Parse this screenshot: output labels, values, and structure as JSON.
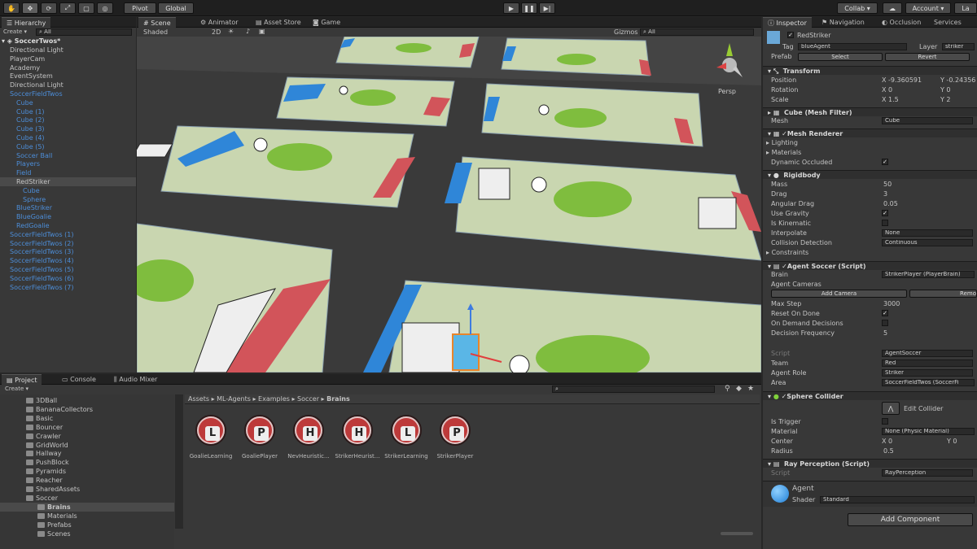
{
  "toolbar": {
    "pivot": "Pivot",
    "global": "Global",
    "collab": "Collab",
    "account": "Account",
    "layers": "La",
    "tool_icons": [
      "hand-icon",
      "move-icon",
      "rotate-icon",
      "scale-icon",
      "rect-icon",
      "transform-icon"
    ]
  },
  "hierarchy": {
    "tab": "Hierarchy",
    "create": "Create",
    "search": "All",
    "scene": "SoccerTwos*",
    "items": [
      {
        "label": "Directional Light",
        "style": "white",
        "indent": 1
      },
      {
        "label": "PlayerCam",
        "style": "white",
        "indent": 1
      },
      {
        "label": "Academy",
        "style": "white",
        "indent": 1
      },
      {
        "label": "EventSystem",
        "style": "white",
        "indent": 1
      },
      {
        "label": "Directional Light",
        "style": "white",
        "indent": 1
      },
      {
        "label": "SoccerFieldTwos",
        "style": "blue",
        "indent": 1
      },
      {
        "label": "Cube",
        "style": "blue",
        "indent": 2
      },
      {
        "label": "Cube (1)",
        "style": "blue",
        "indent": 2
      },
      {
        "label": "Cube (2)",
        "style": "blue",
        "indent": 2
      },
      {
        "label": "Cube (3)",
        "style": "blue",
        "indent": 2
      },
      {
        "label": "Cube (4)",
        "style": "blue",
        "indent": 2
      },
      {
        "label": "Cube (5)",
        "style": "blue",
        "indent": 2
      },
      {
        "label": "Soccer Ball",
        "style": "blue",
        "indent": 2
      },
      {
        "label": "Players",
        "style": "blue",
        "indent": 2
      },
      {
        "label": "Field",
        "style": "blue",
        "indent": 2
      },
      {
        "label": "RedStriker",
        "style": "white",
        "indent": 2,
        "selected": true
      },
      {
        "label": "Cube",
        "style": "blue",
        "indent": 3
      },
      {
        "label": "Sphere",
        "style": "blue",
        "indent": 3
      },
      {
        "label": "BlueStriker",
        "style": "blue",
        "indent": 2
      },
      {
        "label": "BlueGoalie",
        "style": "blue",
        "indent": 2
      },
      {
        "label": "RedGoalie",
        "style": "blue",
        "indent": 2
      },
      {
        "label": "SoccerFieldTwos (1)",
        "style": "blue",
        "indent": 1
      },
      {
        "label": "SoccerFieldTwos (2)",
        "style": "blue",
        "indent": 1
      },
      {
        "label": "SoccerFieldTwos (3)",
        "style": "blue",
        "indent": 1
      },
      {
        "label": "SoccerFieldTwos (4)",
        "style": "blue",
        "indent": 1
      },
      {
        "label": "SoccerFieldTwos (5)",
        "style": "blue",
        "indent": 1
      },
      {
        "label": "SoccerFieldTwos (6)",
        "style": "blue",
        "indent": 1
      },
      {
        "label": "SoccerFieldTwos (7)",
        "style": "blue",
        "indent": 1
      }
    ]
  },
  "scene": {
    "tabs": [
      "Scene",
      "Animator",
      "Asset Store",
      "Game"
    ],
    "shaded": "Shaded",
    "mode2d": "2D",
    "gizmos": "Gizmos",
    "search": "All",
    "persp": "Persp"
  },
  "project": {
    "tabs": [
      "Project",
      "Console",
      "Audio Mixer"
    ],
    "create": "Create",
    "folders": [
      {
        "label": "3DBall",
        "level": 1
      },
      {
        "label": "BananaCollectors",
        "level": 1
      },
      {
        "label": "Basic",
        "level": 1
      },
      {
        "label": "Bouncer",
        "level": 1
      },
      {
        "label": "Crawler",
        "level": 1
      },
      {
        "label": "GridWorld",
        "level": 1
      },
      {
        "label": "Hallway",
        "level": 1
      },
      {
        "label": "PushBlock",
        "level": 1
      },
      {
        "label": "Pyramids",
        "level": 1
      },
      {
        "label": "Reacher",
        "level": 1
      },
      {
        "label": "SharedAssets",
        "level": 1
      },
      {
        "label": "Soccer",
        "level": 1
      },
      {
        "label": "Brains",
        "level": 2,
        "selected": true
      },
      {
        "label": "Materials",
        "level": 2
      },
      {
        "label": "Prefabs",
        "level": 2
      },
      {
        "label": "Scenes",
        "level": 2
      }
    ],
    "breadcrumb": [
      "Assets",
      "ML-Agents",
      "Examples",
      "Soccer",
      "Brains"
    ],
    "assets": [
      {
        "letter": "L",
        "label": "GoalieLearning"
      },
      {
        "letter": "P",
        "label": "GoaliePlayer"
      },
      {
        "letter": "H",
        "label": "NevHeuristic..."
      },
      {
        "letter": "H",
        "label": "StrikerHeurist..."
      },
      {
        "letter": "L",
        "label": "StrikerLearning"
      },
      {
        "letter": "P",
        "label": "StrikerPlayer"
      }
    ]
  },
  "inspector": {
    "tabs": [
      "Inspector",
      "Navigation",
      "Occlusion",
      "Services"
    ],
    "name": "RedStriker",
    "tag_label": "Tag",
    "tag": "blueAgent",
    "layer_label": "Layer",
    "layer": "striker",
    "prefab_label": "Prefab",
    "prefab_select": "Select",
    "prefab_revert": "Revert",
    "transform": {
      "title": "Transform",
      "position_label": "Position",
      "rotation_label": "Rotation",
      "scale_label": "Scale",
      "pos_x": "X -9.360591",
      "pos_y": "Y -0.24356",
      "rot_x": "X 0",
      "rot_y": "Y 0",
      "scale_x": "X 1.5",
      "scale_y": "Y 2"
    },
    "mesh_filter": {
      "title": "Cube (Mesh Filter)",
      "mesh_label": "Mesh",
      "mesh": "Cube"
    },
    "mesh_renderer": {
      "title": "Mesh Renderer",
      "lighting": "Lighting",
      "materials": "Materials",
      "dynamic_occluded": "Dynamic Occluded"
    },
    "rigidbody": {
      "title": "Rigidbody",
      "mass_label": "Mass",
      "mass": "50",
      "drag_label": "Drag",
      "drag": "3",
      "angular_label": "Angular Drag",
      "angular": "0.05",
      "gravity_label": "Use Gravity",
      "kinematic_label": "Is Kinematic",
      "interpolate_label": "Interpolate",
      "interpolate": "None",
      "collision_label": "Collision Detection",
      "collision": "Continuous",
      "constraints_label": "Constraints"
    },
    "agent": {
      "title": "Agent Soccer (Script)",
      "brain_label": "Brain",
      "brain": "StrikerPlayer (PlayerBrain)",
      "cameras_label": "Agent Cameras",
      "add_camera": "Add Camera",
      "remove": "Remo",
      "max_step_label": "Max Step",
      "max_step": "3000",
      "reset_label": "Reset On Done",
      "on_demand_label": "On Demand Decisions",
      "freq_label": "Decision Frequency",
      "freq": "5",
      "script_label": "Script",
      "script": "AgentSoccer",
      "team_label": "Team",
      "team": "Red",
      "role_label": "Agent Role",
      "role": "Striker",
      "area_label": "Area",
      "area": "SoccerFieldTwos (SoccerFi"
    },
    "sphere_collider": {
      "title": "Sphere Collider",
      "edit": "Edit Collider",
      "trigger_label": "Is Trigger",
      "material_label": "Material",
      "material": "None (Physic Material)",
      "center_label": "Center",
      "center_x": "X 0",
      "center_y": "Y 0",
      "radius_label": "Radius",
      "radius": "0.5"
    },
    "ray": {
      "title": "Ray Perception (Script)",
      "script_label": "Script",
      "script": "RayPerception"
    },
    "material": {
      "name": "Agent",
      "shader_label": "Shader",
      "shader": "Standard"
    },
    "add_component": "Add Component"
  },
  "colors": {
    "field": "#c9d6b0",
    "grass": "#7fbd3e",
    "blue_goal": "#2f86d8",
    "red_goal": "#d2545a",
    "selection_blue": "#4d8ed9"
  }
}
